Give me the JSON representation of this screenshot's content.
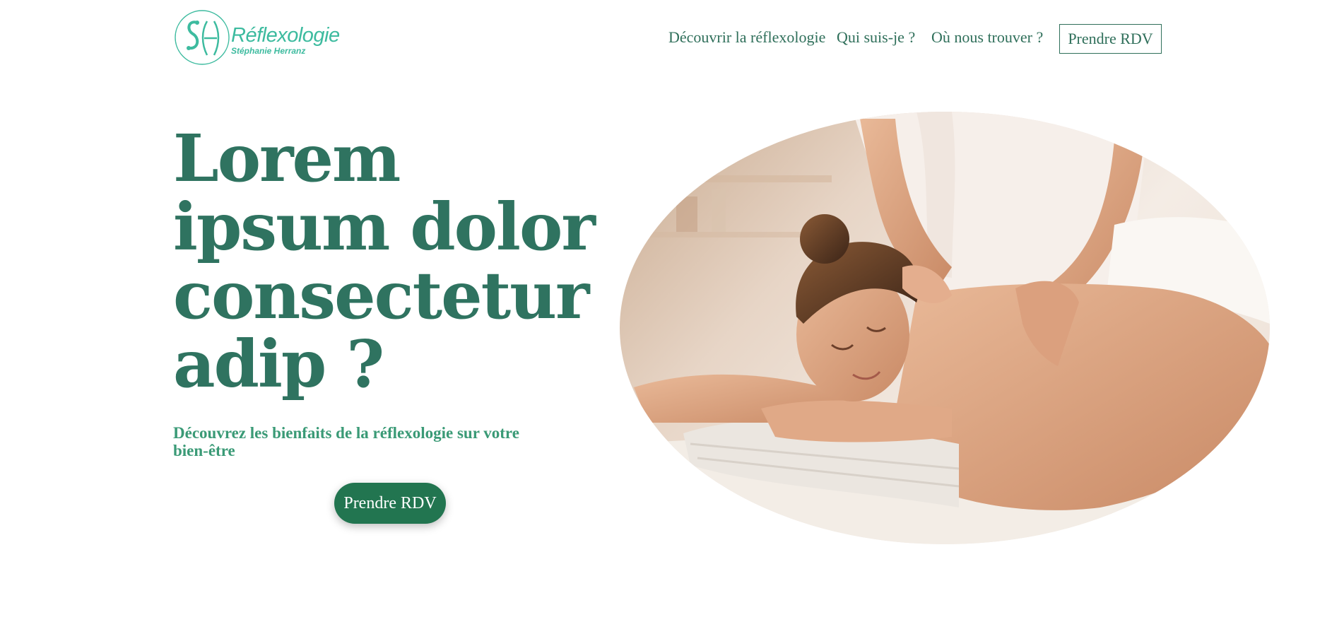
{
  "logo": {
    "title": "Réflexologie",
    "subtitle": "Stéphanie Herranz"
  },
  "nav": {
    "items": [
      "Découvrir la réflexologie",
      "Qui suis-je ?",
      "Où nous trouver ?"
    ],
    "cta_label": "Prendre RDV"
  },
  "hero": {
    "title": "Lorem ipsum dolor consectetur adip ?",
    "subtitle": "Découvrez les bienfaits de la réflexologie sur votre bien-être",
    "cta_label": "Prendre RDV"
  },
  "colors": {
    "primary_green": "#2f7360",
    "button_green": "#227550",
    "accent_teal": "#3dbb9f",
    "subtitle_green": "#3a9a76"
  }
}
